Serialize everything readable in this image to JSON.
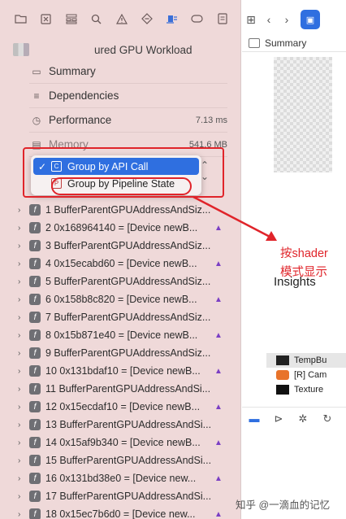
{
  "navigator": {
    "toolbar_icons": [
      "folder-icon",
      "close-square-icon",
      "hierarchy-icon",
      "search-icon",
      "warning-icon",
      "diamond-icon",
      "gpu-debug-icon",
      "capsule-icon",
      "document-icon"
    ],
    "document_title": "ured GPU Workload",
    "summary_items": [
      {
        "icon": "summary-icon",
        "label": "Summary"
      },
      {
        "icon": "dependencies-icon",
        "label": "Dependencies"
      },
      {
        "icon": "performance-icon",
        "label": "Performance",
        "value": "7.13 ms"
      },
      {
        "icon": "memory-icon",
        "label": "Memory",
        "value": "541.6 MB"
      }
    ],
    "group_menu": {
      "options": [
        {
          "label": "Group by API Call",
          "selected": true
        },
        {
          "label": "Group by Pipeline State",
          "selected": false
        }
      ]
    },
    "calls": [
      "0 ...",
      "1 BufferParentGPUAddressAndSiz...",
      "2 0x168964140 = [Device newB...",
      "3 BufferParentGPUAddressAndSiz...",
      "4 0x15ecabd60 = [Device newB...",
      "5 BufferParentGPUAddressAndSiz...",
      "6 0x158b8c820 = [Device newB...",
      "7 BufferParentGPUAddressAndSiz...",
      "8 0x15b871e40 = [Device newB...",
      "9 BufferParentGPUAddressAndSiz...",
      "10 0x131bdaf10 = [Device newB...",
      "11 BufferParentGPUAddressAndSi...",
      "12 0x15ecdaf10 = [Device newB...",
      "13 BufferParentGPUAddressAndSi...",
      "14 0x15af9b340 = [Device newB...",
      "15 BufferParentGPUAddressAndSi...",
      "16 0x131bd38e0 = [Device new...",
      "17 BufferParentGPUAddressAndSi...",
      "18 0x15ec7b6d0 = [Device new..."
    ]
  },
  "annotation": {
    "line1": "按shader",
    "line2": "模式显示",
    "color": "#e0242a"
  },
  "editor": {
    "tab_label": "Summary",
    "insights_label": "Insights",
    "resources": [
      {
        "label": "TempBu",
        "selected": true
      },
      {
        "label": "[R] Cam",
        "selected": false
      },
      {
        "label": "Texture",
        "selected": false
      }
    ]
  },
  "watermark": "知乎 @一滴血的记忆"
}
